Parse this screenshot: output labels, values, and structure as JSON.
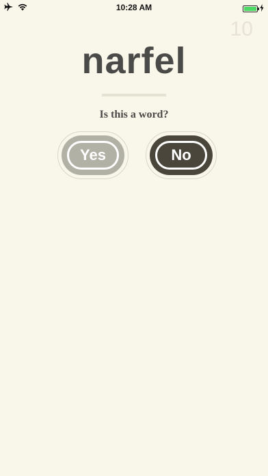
{
  "status_bar": {
    "time": "10:28 AM",
    "icons": [
      "airplane-icon",
      "wifi-icon",
      "battery-icon",
      "charging-bolt-icon"
    ],
    "battery_color": "#4cd964"
  },
  "counter": "10",
  "word": "narfel",
  "question": "Is this a word?",
  "buttons": {
    "yes_label": "Yes",
    "no_label": "No"
  },
  "colors": {
    "background": "#f9f6ea",
    "text_dark": "#4a4a48",
    "yes_button": "#b2b1a6",
    "no_button": "#4a463b",
    "counter": "#e7e4d5"
  }
}
